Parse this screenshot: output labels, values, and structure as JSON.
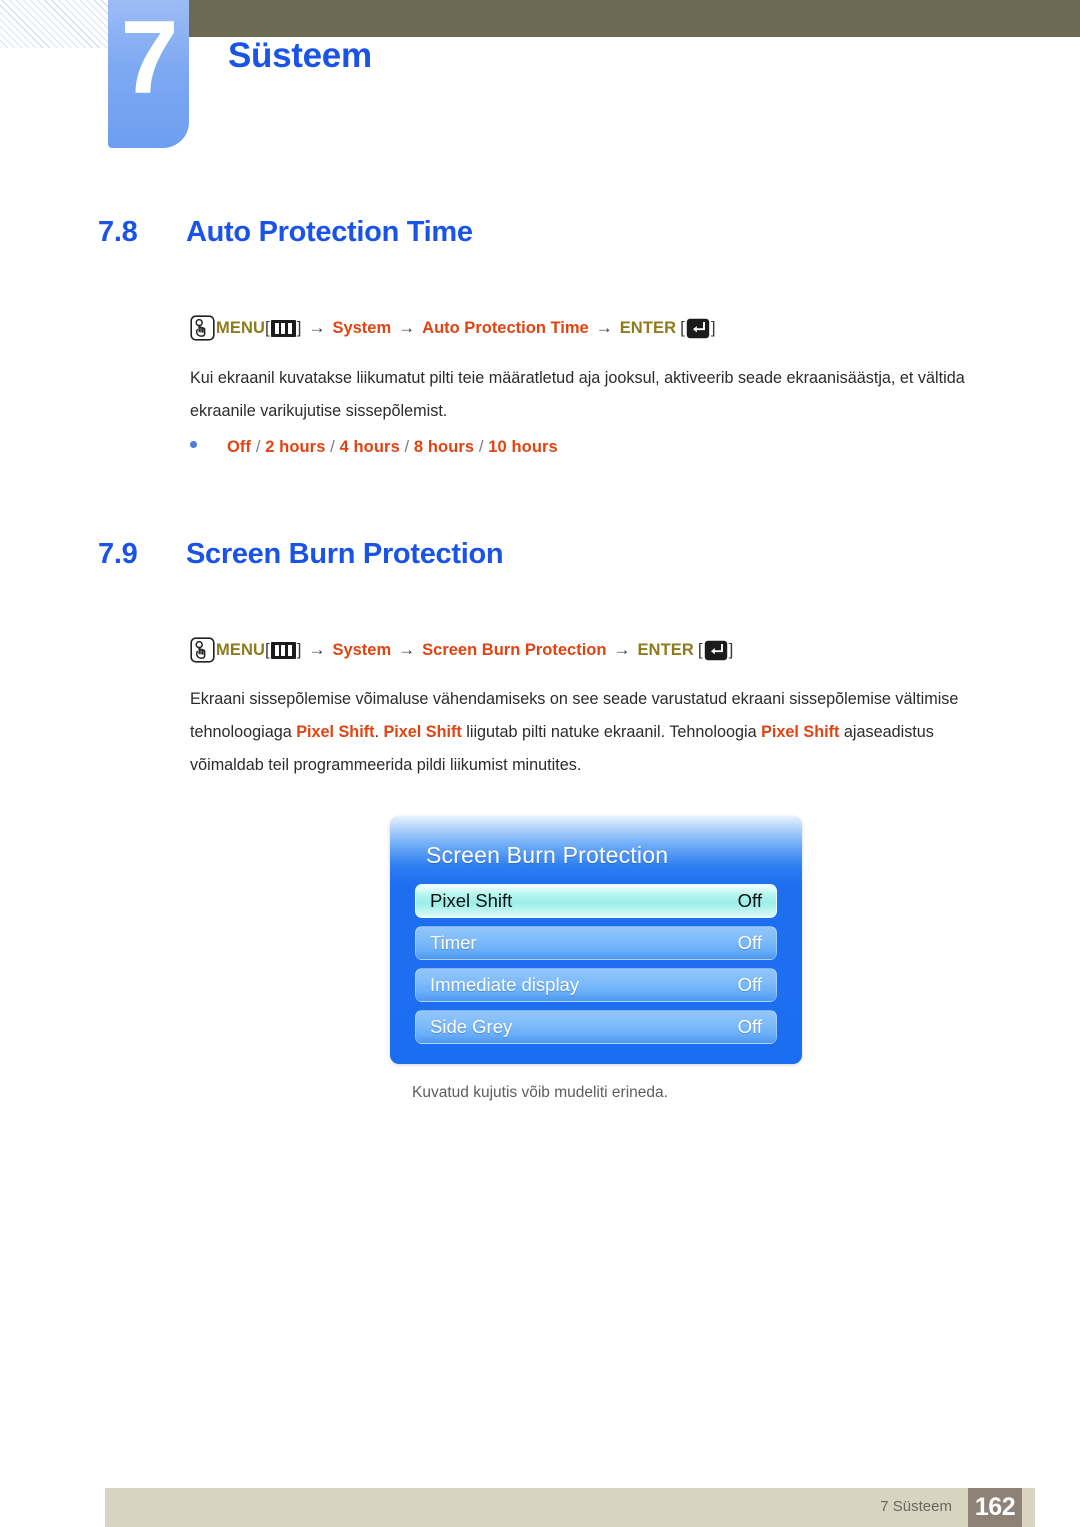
{
  "header": {
    "chapter_number": "7",
    "chapter_title": "Süsteem"
  },
  "sections": [
    {
      "number": "7.8",
      "title": "Auto Protection Time",
      "menu_path": {
        "hand_icon": "hand-press-icon",
        "menu_label": "MENU",
        "menu_icon": "menu-bars-icon",
        "arrow": "→",
        "bracket_open": "[",
        "bracket_close": "]",
        "items": [
          "System",
          "Auto Protection Time"
        ],
        "enter_label": "ENTER",
        "enter_icon": "enter-key-icon"
      },
      "body_prefix": "Kui ekraanil kuvatakse liikumatut pilti teie määratletud aja jooksul, aktiveerib seade ekraanisäästja, et vältida ekraanile varikujutise sissepõlemist.",
      "bullet": {
        "bullet_icon": "bullet-dot-icon",
        "options": [
          "Off",
          "2 hours",
          "4 hours",
          "8 hours",
          "10 hours"
        ],
        "separator": "/"
      }
    },
    {
      "number": "7.9",
      "title": "Screen Burn Protection",
      "menu_path": {
        "hand_icon": "hand-press-icon",
        "menu_label": "MENU",
        "menu_icon": "menu-bars-icon",
        "arrow": "→",
        "bracket_open": "[",
        "bracket_close": "]",
        "items": [
          "System",
          "Screen Burn Protection"
        ],
        "enter_label": "ENTER",
        "enter_icon": "enter-key-icon"
      },
      "body_part1": "Ekraani sissepõlemise võimaluse vähendamiseks on see seade varustatud ekraani sissepõlemise vältimise tehnoloogiaga ",
      "body_highlight1": "Pixel Shift",
      "body_part2": ". ",
      "body_highlight2": "Pixel Shift",
      "body_part3": " liigutab pilti natuke ekraanil. Tehnoloogia ",
      "body_highlight3": "Pixel Shift",
      "body_part4": " ajaseadistus võimaldab teil programmeerida pildi liikumist minutites."
    }
  ],
  "osd": {
    "title": "Screen Burn Protection",
    "rows": [
      {
        "label": "Pixel Shift",
        "value": "Off",
        "selected": true
      },
      {
        "label": "Timer",
        "value": "Off",
        "selected": false
      },
      {
        "label": "Immediate display",
        "value": "Off",
        "selected": false
      },
      {
        "label": "Side Grey",
        "value": "Off",
        "selected": false
      }
    ],
    "caption": "Kuvatud kujutis võib mudeliti erineda."
  },
  "footer": {
    "label": "7 Süsteem",
    "page_number": "162"
  },
  "colors": {
    "heading_blue": "#1a53e8",
    "accent_red": "#e24310",
    "menu_olive": "#907a1e",
    "olive_bar": "#6d6a53",
    "tab_blue": "#7ea9f2",
    "footer_bar": "#d9d4c1",
    "footer_page_box": "#8e8175",
    "osd_blue": "#1c6ef0",
    "osd_selected": "#9aeee8"
  }
}
